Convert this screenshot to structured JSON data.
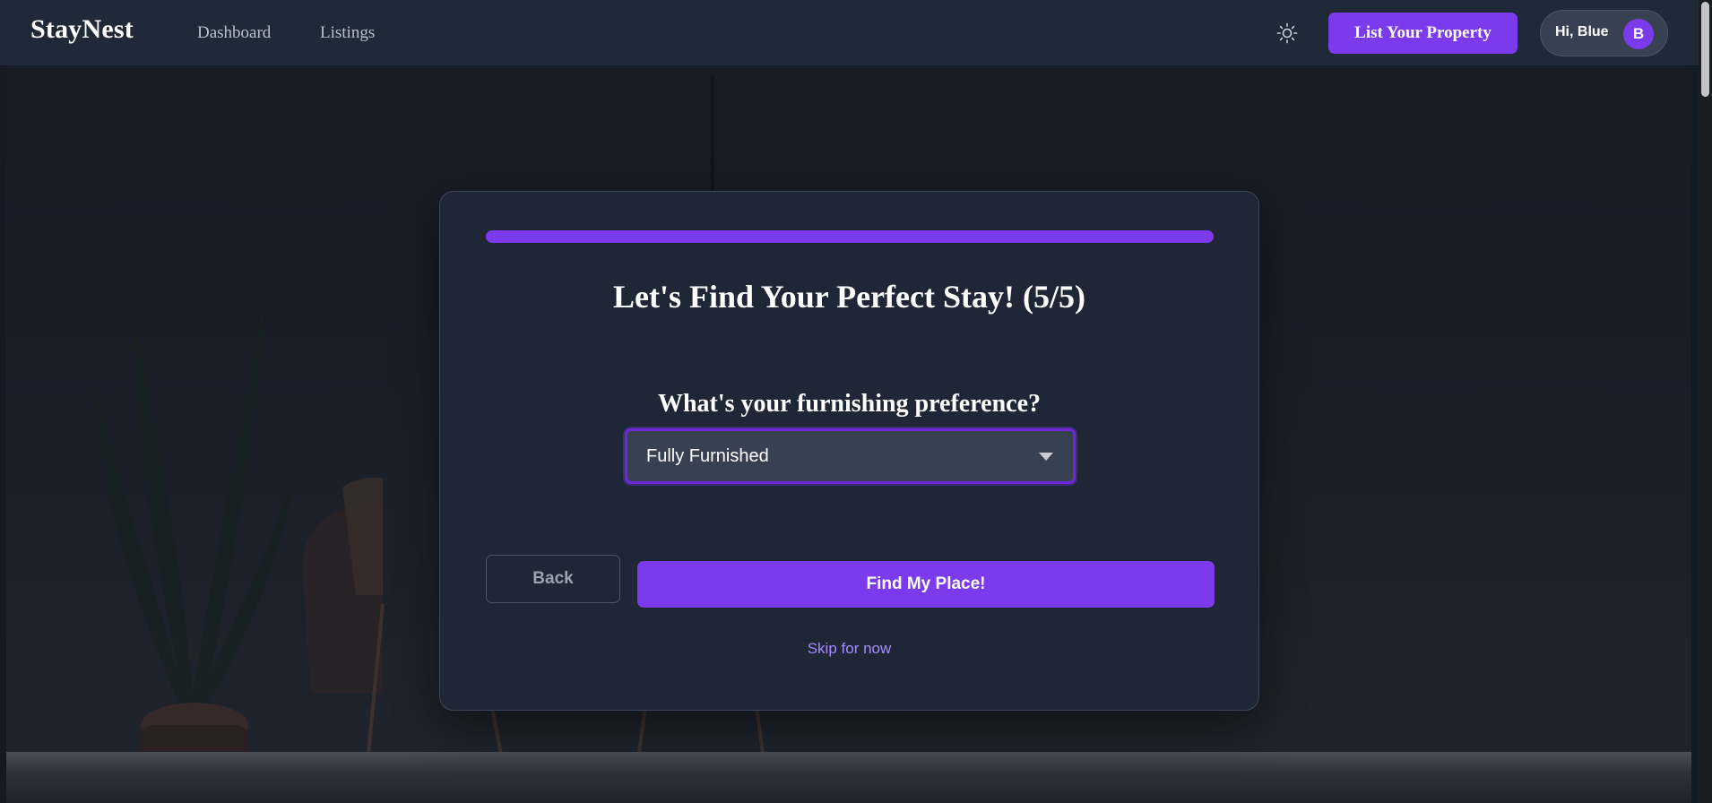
{
  "navbar": {
    "brand": "StayNest",
    "links": [
      "Dashboard",
      "Listings"
    ],
    "theme_icon": "sun-icon",
    "cta_label": "List Your Property",
    "user": {
      "greeting": "Hi, Blue",
      "avatar_initial": "B"
    }
  },
  "wizard": {
    "progress_percent": 100,
    "title": "Let's Find Your Perfect Stay! (5/5)",
    "question": "What's your furnishing preference?",
    "select": {
      "value": "Fully Furnished",
      "icon": "chevron-down-icon"
    },
    "back_label": "Back",
    "submit_label": "Find My Place!",
    "skip_label": "Skip for now"
  },
  "colors": {
    "accent": "#7c3aed",
    "navbar_bg": "#1f2937",
    "card_bg": "#1f2737",
    "link_accent": "#a78bfa"
  }
}
